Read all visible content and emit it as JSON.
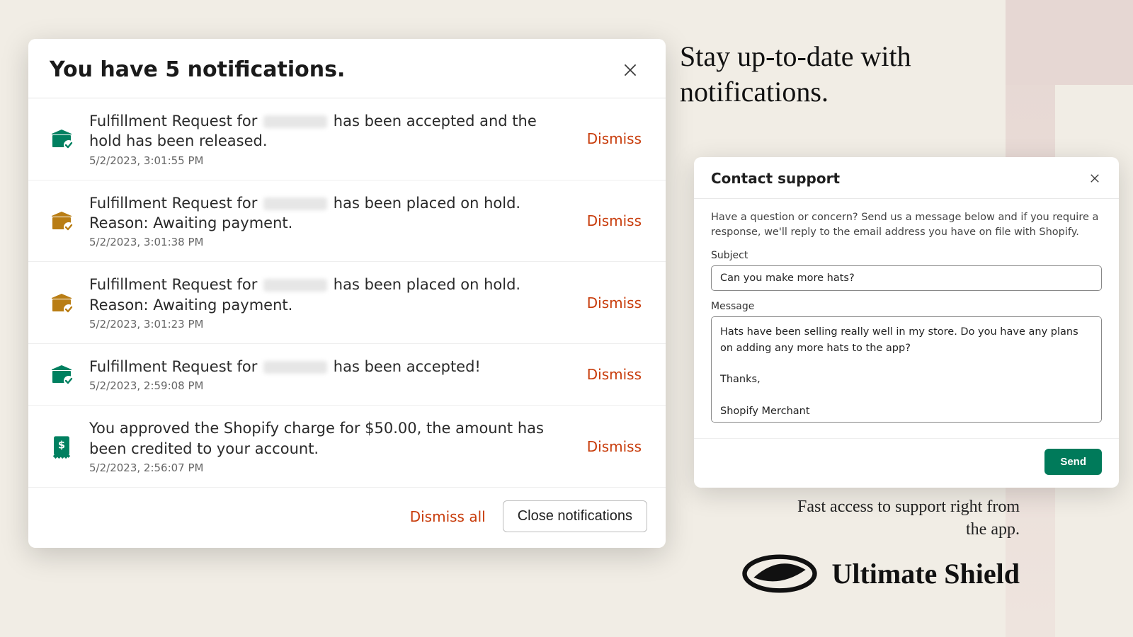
{
  "headline": "Stay up-to-date with notifications.",
  "subline": "Fast access to support right from the app.",
  "logo_text": "Ultimate Shield",
  "notifications": {
    "title": "You have 5 notifications.",
    "dismiss_label": "Dismiss",
    "dismiss_all_label": "Dismiss all",
    "close_label": "Close notifications",
    "items": [
      {
        "icon": "box-check-green",
        "text_before": "Fulfillment Request for ",
        "text_after": " has been accepted and the hold has been released.",
        "redacted": true,
        "time": "5/2/2023, 3:01:55 PM"
      },
      {
        "icon": "box-check-amber",
        "text_before": "Fulfillment Request for ",
        "text_after": " has been placed on hold. Reason: Awaiting payment.",
        "redacted": true,
        "time": "5/2/2023, 3:01:38 PM"
      },
      {
        "icon": "box-check-amber",
        "text_before": "Fulfillment Request for ",
        "text_after": " has been placed on hold. Reason: Awaiting payment.",
        "redacted": true,
        "time": "5/2/2023, 3:01:23 PM"
      },
      {
        "icon": "box-check-green",
        "text_before": "Fulfillment Request for ",
        "text_after": " has been accepted!",
        "redacted": true,
        "time": "5/2/2023, 2:59:08 PM"
      },
      {
        "icon": "receipt-green",
        "text_before": "You approved the Shopify charge for $50.00, the amount has been credited to your account.",
        "text_after": "",
        "redacted": false,
        "time": "5/2/2023, 2:56:07 PM"
      }
    ]
  },
  "support": {
    "title": "Contact support",
    "intro": "Have a question or concern? Send us a message below and if you require a response, we'll reply to the email address you have on file with Shopify.",
    "subject_label": "Subject",
    "subject_value": "Can you make more hats?",
    "message_label": "Message",
    "message_value": "Hats have been selling really well in my store. Do you have any plans on adding any more hats to the app?\n\nThanks,\n\nShopify Merchant",
    "send_label": "Send"
  },
  "colors": {
    "dismiss": "#c83c0b",
    "green": "#008060",
    "amber": "#b97d14"
  }
}
